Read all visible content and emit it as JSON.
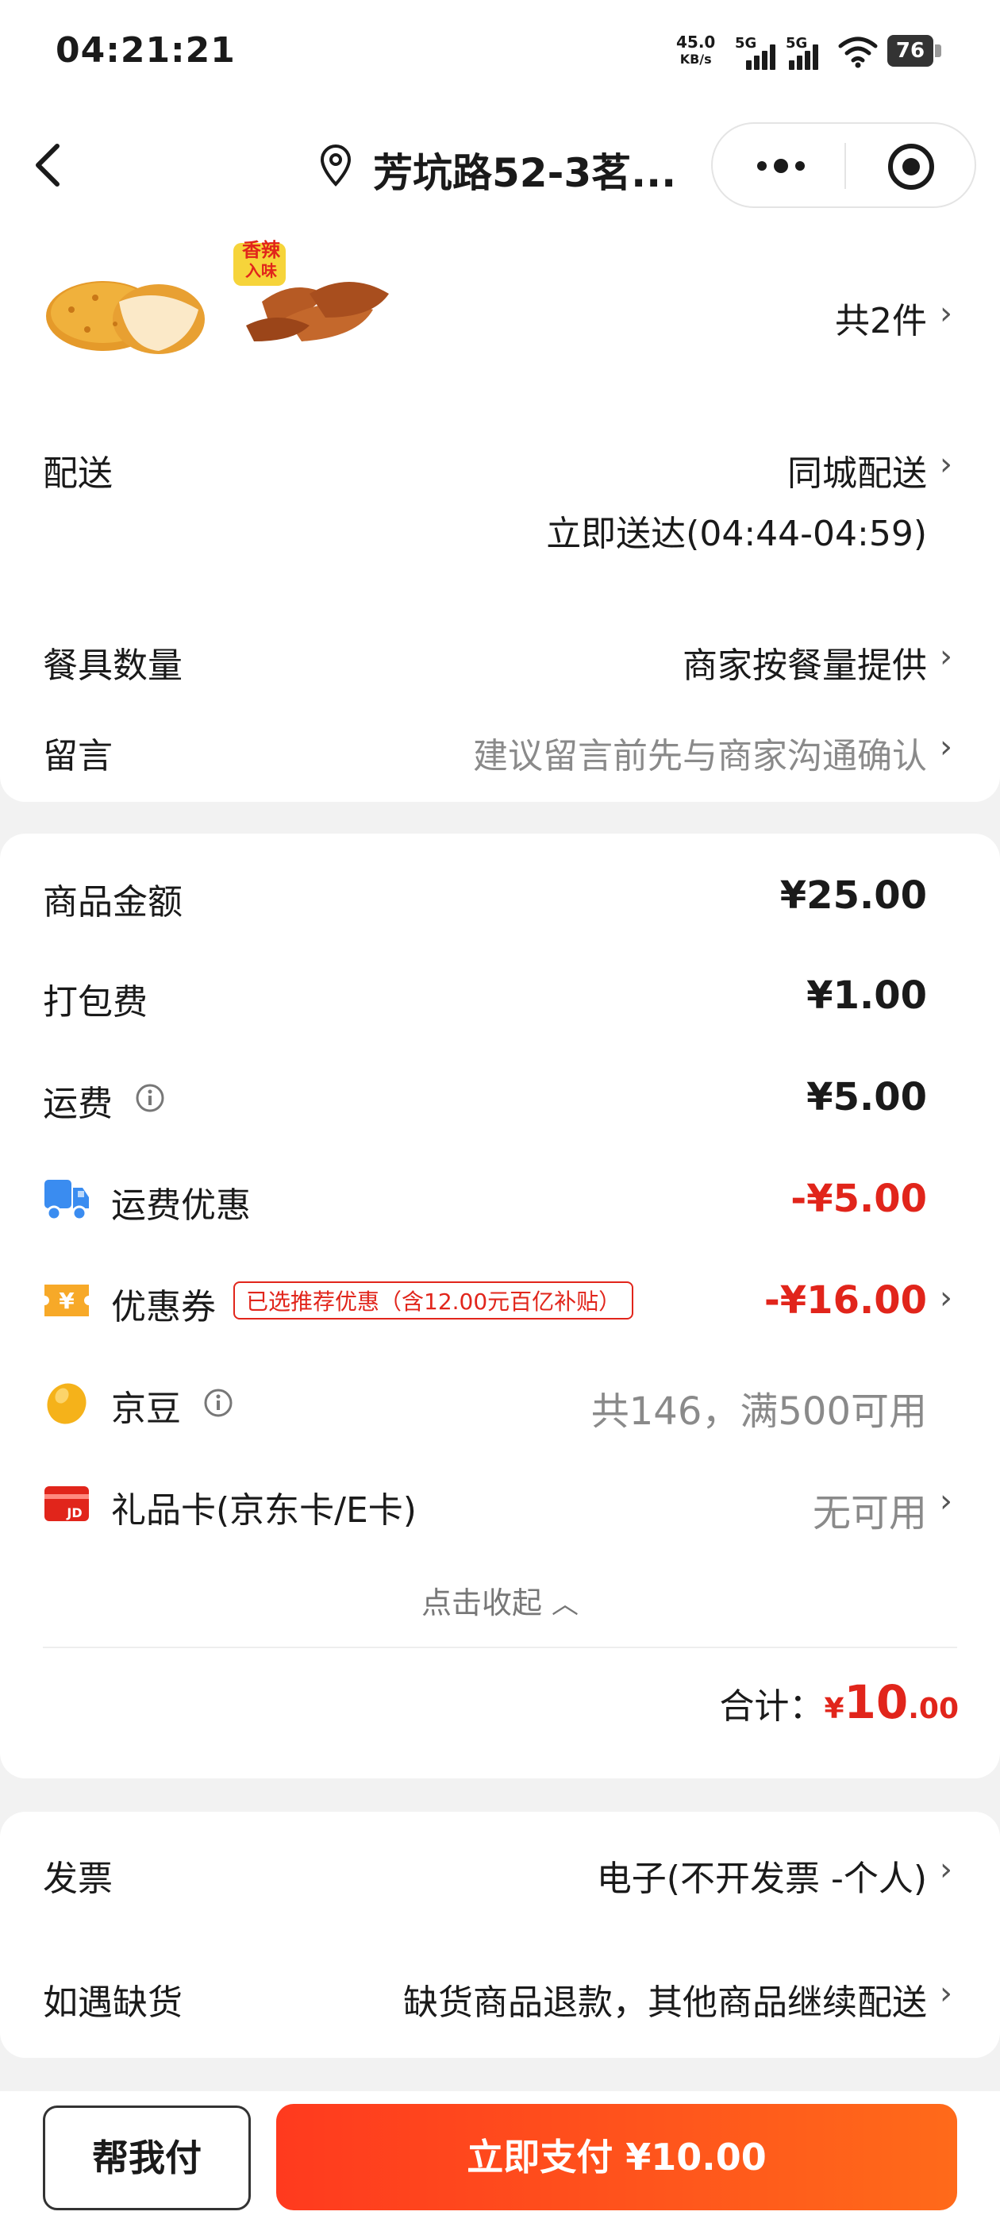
{
  "status_bar": {
    "time": "04:21:21",
    "net_speed": "45.0",
    "net_unit": "KB/s",
    "sim1": "5G",
    "sim2": "5G",
    "battery": "76"
  },
  "header": {
    "title": "芳坑路52-3茗...",
    "back_icon": "chevron-left-icon",
    "location_icon": "map-pin-icon",
    "more_icon": "more-dots-icon",
    "target_icon": "target-icon"
  },
  "products": {
    "count_label": "共2件",
    "images": [
      "fried-chicken-cutlet",
      "spicy-chicken-wings"
    ],
    "wing_badge_line1": "香辣",
    "wing_badge_line2": "入味"
  },
  "delivery": {
    "label": "配送",
    "method": "同城配送",
    "time": "立即送达(04:44-04:59)"
  },
  "tableware": {
    "label": "餐具数量",
    "value": "商家按餐量提供"
  },
  "remark": {
    "label": "留言",
    "placeholder": "建议留言前先与商家沟通确认"
  },
  "price": {
    "goods_label": "商品金额",
    "goods_value": "¥25.00",
    "packing_label": "打包费",
    "packing_value": "¥1.00",
    "shipping_label": "运费",
    "shipping_value": "¥5.00",
    "shipping_discount_label": "运费优惠",
    "shipping_discount_value": "-¥5.00",
    "coupon_label": "优惠券",
    "coupon_tag": "已选推荐优惠（含12.00元百亿补贴）",
    "coupon_value": "-¥16.00",
    "bean_label": "京豆",
    "bean_value": "共146，满500可用",
    "giftcard_label": "礼品卡(京东卡/E卡)",
    "giftcard_value": "无可用",
    "collapse_label": "点击收起",
    "total_label": "合计：",
    "total_symbol": "¥",
    "total_int": "10",
    "total_dec": ".00",
    "accent_color": "#e1251b"
  },
  "invoice": {
    "label": "发票",
    "value": "电子(不开发票 -个人)"
  },
  "stockout": {
    "label": "如遇缺货",
    "value": "缺货商品退款，其他商品继续配送"
  },
  "bottom": {
    "help_pay": "帮我付",
    "pay_now": "立即支付 ¥10.00"
  }
}
